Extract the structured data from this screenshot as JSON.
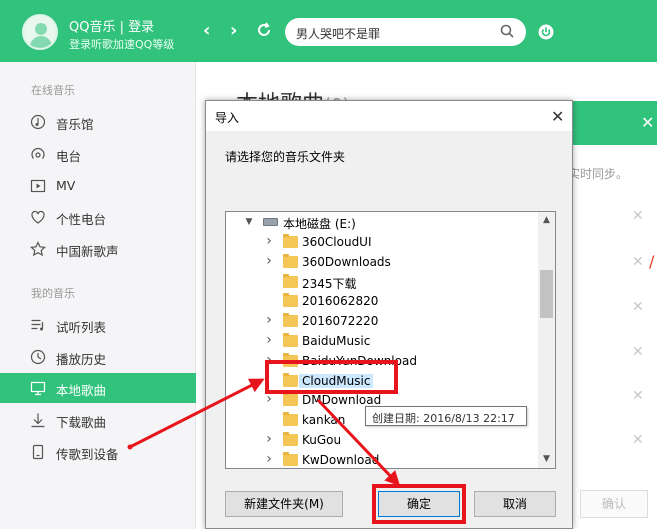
{
  "header": {
    "app_title": "QQ音乐 | 登录",
    "app_subtitle": "登录听歌加速QQ等级",
    "back_icon": "chevron-left-icon",
    "forward_icon": "chevron-right-icon",
    "refresh_icon": "refresh-icon",
    "search_value": "男人哭吧不是罪",
    "search_icon": "search-icon",
    "power_icon": "power-icon",
    "accent_color": "#31c27c"
  },
  "sidebar": {
    "online_section": "在线音乐",
    "online_items": [
      {
        "label": "音乐馆",
        "icon": "music-hall-icon"
      },
      {
        "label": "电台",
        "icon": "radio-icon"
      },
      {
        "label": "MV",
        "icon": "mv-icon"
      },
      {
        "label": "个性电台",
        "icon": "heart-radio-icon"
      },
      {
        "label": "中国新歌声",
        "icon": "star-icon"
      }
    ],
    "my_section": "我的音乐",
    "my_items": [
      {
        "label": "试听列表",
        "icon": "playlist-icon"
      },
      {
        "label": "播放历史",
        "icon": "clock-icon"
      },
      {
        "label": "本地歌曲",
        "icon": "monitor-icon",
        "active": true
      },
      {
        "label": "下载歌曲",
        "icon": "download-icon"
      },
      {
        "label": "传歌到设备",
        "icon": "device-icon"
      }
    ]
  },
  "main": {
    "title": "本地歌曲",
    "count": "(0)",
    "sync_text": "实时同步。",
    "confirm_label": "确认"
  },
  "dialog": {
    "title": "导入",
    "prompt": "请选择您的音乐文件夹",
    "drive_label": "本地磁盘 (E:)",
    "folders": [
      {
        "name": "360CloudUI",
        "expandable": true
      },
      {
        "name": "360Downloads",
        "expandable": true
      },
      {
        "name": "2345下载",
        "expandable": false
      },
      {
        "name": "2016062820",
        "expandable": false
      },
      {
        "name": "2016072220",
        "expandable": true
      },
      {
        "name": "BaiduMusic",
        "expandable": true
      },
      {
        "name": "BaiduYunDownload",
        "expandable": true
      },
      {
        "name": "CloudMusic",
        "expandable": false,
        "selected": true
      },
      {
        "name": "DMDownload",
        "expandable": true
      },
      {
        "name": "kankan",
        "expandable": false
      },
      {
        "name": "KuGou",
        "expandable": true
      },
      {
        "name": "KwDownload",
        "expandable": true
      }
    ],
    "tooltip": "创建日期: 2016/8/13 22:17",
    "new_folder_button": "新建文件夹(M)",
    "ok_button": "确定",
    "cancel_button": "取消",
    "annotation_color": "#e8141b"
  }
}
